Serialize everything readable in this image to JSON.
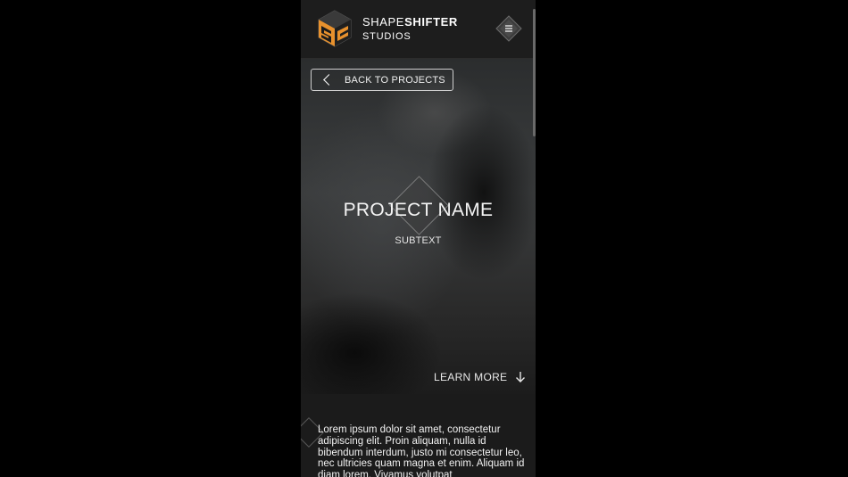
{
  "header": {
    "brand_part1": "SHAPE",
    "brand_part2": "SHIFTER",
    "brand_sub": "STUDIOS",
    "logo_icon": "shapeshifter-cube-logo",
    "menu_icon": "hamburger-menu-icon"
  },
  "hero": {
    "back_label": "BACK TO PROJECTS",
    "title": "PROJECT NAME",
    "subtitle": "SUBTEXT",
    "learn_more_label": "LEARN MORE"
  },
  "content": {
    "paragraph": "Lorem ipsum dolor sit amet, consectetur adipiscing elit. Proin aliquam, nulla id bibendum interdum, justo mi consectetur leo, nec ultricies quam magna et enim. Aliquam id diam lorem. Vivamus volutpat"
  },
  "colors": {
    "accent": "#e8912d",
    "background": "#000000",
    "panel": "#1b1b1b"
  }
}
